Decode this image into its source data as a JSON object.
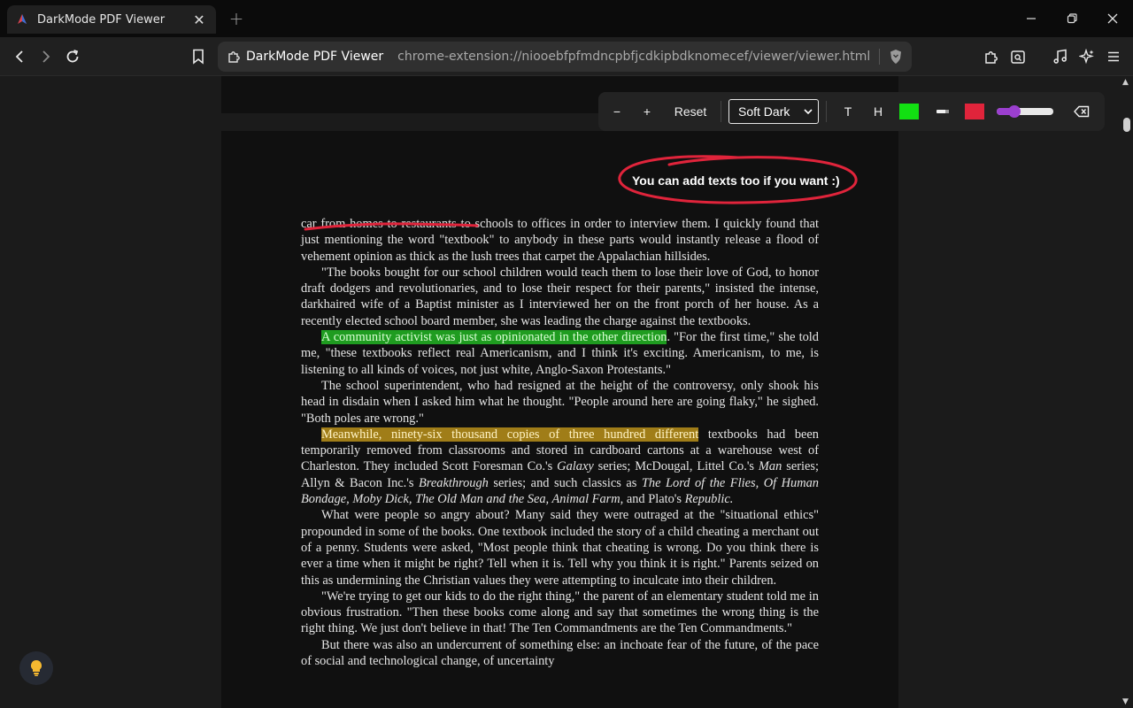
{
  "tab": {
    "title": "DarkMode PDF Viewer"
  },
  "omnibox": {
    "site": "DarkMode PDF Viewer",
    "url": "chrome-extension://niooebfpfmdncpbfjcdkipbdknomecef/viewer/viewer.html?file=file..."
  },
  "controls": {
    "zoom_out": "−",
    "zoom_in": "+",
    "reset": "Reset",
    "theme_selected": "Soft Dark",
    "text_tool": "T",
    "highlight_tool": "H",
    "highlight_color": "#12e012",
    "ink_color": "#e0243b",
    "stroke_width_level": 0.25
  },
  "annotations": {
    "added_text": "You can add texts too if you want :)"
  },
  "document": {
    "p1": {
      "underlined": "car from homes to restaurants t",
      "rest": "o schools to offices in order to interview them. I quickly found that just mentioning the word \"textbook\" to anybody in these parts would instantly release a flood of vehement opinion as thick as the lush trees that carpet the Appalachian hillsides."
    },
    "p2": "\"The books bought for our school children would teach them to lose their love of God, to honor draft dodgers and revolutionaries, and to lose their respect for their parents,\" insisted the intense, darkhaired wife of a Baptist minister as I interviewed her on the front porch of her house. As a recently elected school board member, she was leading the charge against the textbooks.",
    "p3": {
      "highlight": "A community activist was just as opinionated in the other direction",
      "rest": ". \"For the first time,\" she told me, \"these textbooks reflect real Americanism, and I think it's exciting. Americanism, to me, is listening to all kinds of voices, not just white, Anglo-Saxon Protestants.\""
    },
    "p4": "The school superintendent, who had resigned at the height of the controversy, only shook his head in disdain when I asked him what he thought. \"People around here are going flaky,\" he sighed. \"Both poles are wrong.\"",
    "p5": {
      "highlight": "Meanwhile, ninety-six thousand copies of three hundred different",
      "a": " textbooks had been temporarily removed from classrooms and stored in cardboard cartons at a warehouse west of Charleston. They included Scott Foresman Co.'s ",
      "i1": "Galaxy",
      "b": " series; McDougal, Littel Co.'s ",
      "i2": "Man",
      "c": " series; Allyn & Bacon Inc.'s ",
      "i3": "Breakthrough",
      "d": " series; and such classics as ",
      "i4": "The Lord of the Flies, Of Human Bondage, Moby Dick, The Old Man and the Sea, Animal Farm,",
      "e": " and Plato's ",
      "i5": "Republic."
    },
    "p6": "What were people so angry about? Many said they were outraged at the \"situational ethics\" propounded in some of the books. One textbook included the story of a child cheating a merchant out of a penny. Students were asked, \"Most people think that cheating is wrong. Do you think there is ever a time when it might be right? Tell when it is. Tell why you think it is right.\" Parents seized on this as undermining the Christian values they were attempting to inculcate into their children.",
    "p7": "\"We're trying to get our kids to do the right thing,\" the parent of an elementary student told me in obvious frustration. \"Then these books come along and say that sometimes the wrong thing is the right thing. We just don't believe in that! The Ten Commandments are the Ten Commandments.\"",
    "p8": "But there was also an undercurrent of something else: an inchoate fear of the future, of the pace of social and technological change, of uncertainty"
  }
}
